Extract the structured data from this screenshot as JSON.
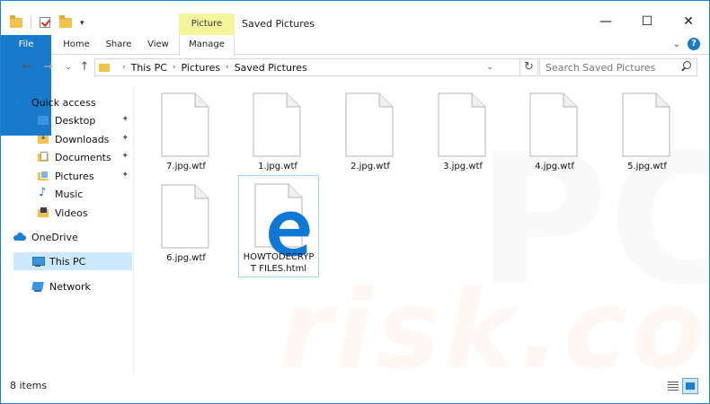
{
  "window": {
    "title": "Saved Pictures",
    "context_tab": "Picture Tools",
    "controls": {
      "minimize": "—",
      "maximize": "☐",
      "close": "✕"
    }
  },
  "ribbon": {
    "tabs": [
      "File",
      "Home",
      "Share",
      "View",
      "Manage"
    ],
    "expand": "⌄",
    "help": "?"
  },
  "nav": {
    "back": "←",
    "forward": "→",
    "recent": "⌄",
    "up": "↑",
    "breadcrumb": [
      "This PC",
      "Pictures",
      "Saved Pictures"
    ],
    "address_dropdown": "⌄",
    "refresh": "↻",
    "search_placeholder": "Search Saved Pictures"
  },
  "sidebar": {
    "quick_access": "Quick access",
    "items": [
      {
        "label": "Desktop",
        "pinned": true
      },
      {
        "label": "Downloads",
        "pinned": true
      },
      {
        "label": "Documents",
        "pinned": true
      },
      {
        "label": "Pictures",
        "pinned": true
      },
      {
        "label": "Music",
        "pinned": false
      },
      {
        "label": "Videos",
        "pinned": false
      }
    ],
    "onedrive": "OneDrive",
    "this_pc": "This PC",
    "network": "Network",
    "pin_glyph": "📌"
  },
  "files": [
    {
      "name": "7.jpg.wtf",
      "type": "blank"
    },
    {
      "name": "1.jpg.wtf",
      "type": "blank"
    },
    {
      "name": "2.jpg.wtf",
      "type": "blank"
    },
    {
      "name": "3.jpg.wtf",
      "type": "blank"
    },
    {
      "name": "4.jpg.wtf",
      "type": "blank"
    },
    {
      "name": "5.jpg.wtf",
      "type": "blank"
    },
    {
      "name": "6.jpg.wtf",
      "type": "blank"
    },
    {
      "name": "HOWTODECRYPT FILES.html",
      "type": "edge-html"
    }
  ],
  "status": {
    "item_count": "8 items"
  },
  "colors": {
    "accent": "#1979ca",
    "context_tab": "#f5f59c",
    "selected": "#cce8ff",
    "edge_blue": "#0f78d4"
  },
  "watermark": {
    "text": "risk.com",
    "logo": "PC"
  }
}
